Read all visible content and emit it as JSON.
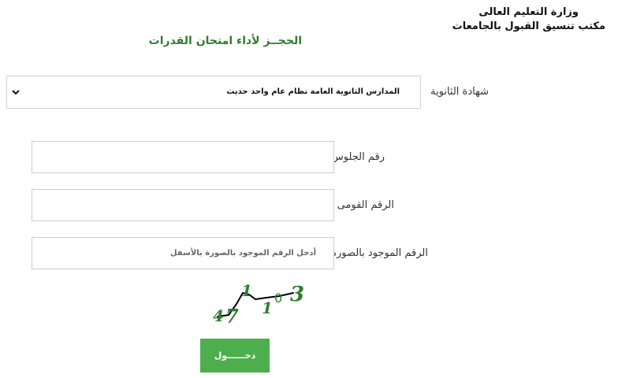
{
  "header": {
    "ministry": "وزارة التعليم العالى",
    "office": "مكتب تنسيق القبول بالجامعات"
  },
  "page": {
    "title": "الحجــز لأداء امتحان القدرات"
  },
  "form": {
    "certificate_label": "شهادة الثانوية",
    "certificate_selected": "المدارس الثانوية العامة نظام عام واحد حديث",
    "seat_number_label": "رقم الجلوس",
    "national_id_label": "الرقم القومى",
    "captcha_label": "الرقم الموجود بالصورة",
    "captcha_placeholder": "أدخل الرقم الموجود بالصورة بالأسفل",
    "captcha_digits": [
      "4",
      "7",
      "1",
      "1",
      "0",
      "3"
    ],
    "submit_label": "دخــــــول"
  },
  "colors": {
    "accent_green": "#2e7d32",
    "button_green": "#4cae4c"
  },
  "icons": {
    "select_arrow": "chevron-down-icon"
  }
}
